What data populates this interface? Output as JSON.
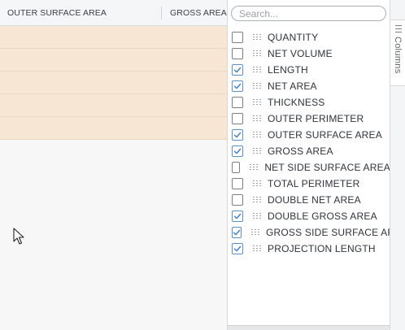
{
  "grid": {
    "columns": [
      "OUTER SURFACE AREA",
      "GROSS AREA"
    ],
    "row_count": 5
  },
  "columns_panel": {
    "search_placeholder": "Search...",
    "items": [
      {
        "label": "QUANTITY",
        "checked": false
      },
      {
        "label": "NET VOLUME",
        "checked": false
      },
      {
        "label": "LENGTH",
        "checked": true
      },
      {
        "label": "NET AREA",
        "checked": true
      },
      {
        "label": "THICKNESS",
        "checked": false
      },
      {
        "label": "OUTER PERIMETER",
        "checked": false
      },
      {
        "label": "OUTER SURFACE AREA",
        "checked": true
      },
      {
        "label": "GROSS AREA",
        "checked": true
      },
      {
        "label": "NET SIDE SURFACE AREA",
        "checked": false
      },
      {
        "label": "TOTAL PERIMETER",
        "checked": false
      },
      {
        "label": "DOUBLE NET AREA",
        "checked": false
      },
      {
        "label": "DOUBLE GROSS AREA",
        "checked": true
      },
      {
        "label": "GROSS SIDE SURFACE AREA",
        "checked": true
      },
      {
        "label": "PROJECTION LENGTH",
        "checked": true
      }
    ]
  },
  "sidebar": {
    "tab_label": "Columns",
    "tab_icon": "columns-icon"
  },
  "colors": {
    "row_highlight": "#f8e6d4",
    "check_accent": "#5a8fc8"
  }
}
